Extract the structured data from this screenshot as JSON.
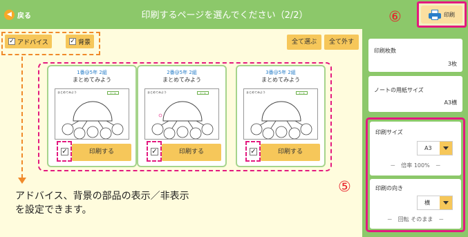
{
  "header": {
    "back_label": "戻る",
    "title": "印刷するページを選んでください（2/2）",
    "step_marker": "⑥",
    "print_label": "印刷"
  },
  "toggles": {
    "advice_label": "アドバイス",
    "background_label": "背景",
    "advice_checked": true,
    "background_checked": true
  },
  "selection": {
    "select_all": "全て選ぶ",
    "deselect_all": "全て外す"
  },
  "cards": [
    {
      "class_label": "1番@5年 2組",
      "title": "まとめてみよう",
      "thumb_title": "まとめてみよう",
      "thumb_badge": "まとめ",
      "print_label": "印刷する",
      "checked": true
    },
    {
      "class_label": "2番@5年 2組",
      "title": "まとめてみよう",
      "thumb_title": "まとめてみよう",
      "thumb_badge": "まとめ",
      "print_label": "印刷する",
      "checked": true
    },
    {
      "class_label": "3番@5年 2組",
      "title": "まとめてみよう",
      "thumb_title": "まとめてみよう",
      "thumb_badge": "まとめ",
      "print_label": "印刷する",
      "checked": true
    }
  ],
  "caption": {
    "line1": "アドバイス、背景の部品の表示／非表示",
    "line2": "を設定できます。"
  },
  "step5_marker": "⑤",
  "settings": {
    "copies_label": "印刷枚数",
    "copies_value": "3枚",
    "paper_label": "ノートの用紙サイズ",
    "paper_value": "A3横",
    "print_size_label": "印刷サイズ",
    "print_size_value": "A3",
    "scale_text": "－　倍率 100%　－",
    "orientation_label": "印刷の向き",
    "orientation_value": "横",
    "rotation_text": "－　回転 そのまま　－"
  },
  "colors": {
    "header_green": "#8cc86a",
    "content_bg": "#fffcdd",
    "button_yellow": "#f6c75a",
    "highlight_pink": "#e3197f",
    "annotation_orange": "#f08a2a",
    "marker_red": "#e8202a"
  }
}
